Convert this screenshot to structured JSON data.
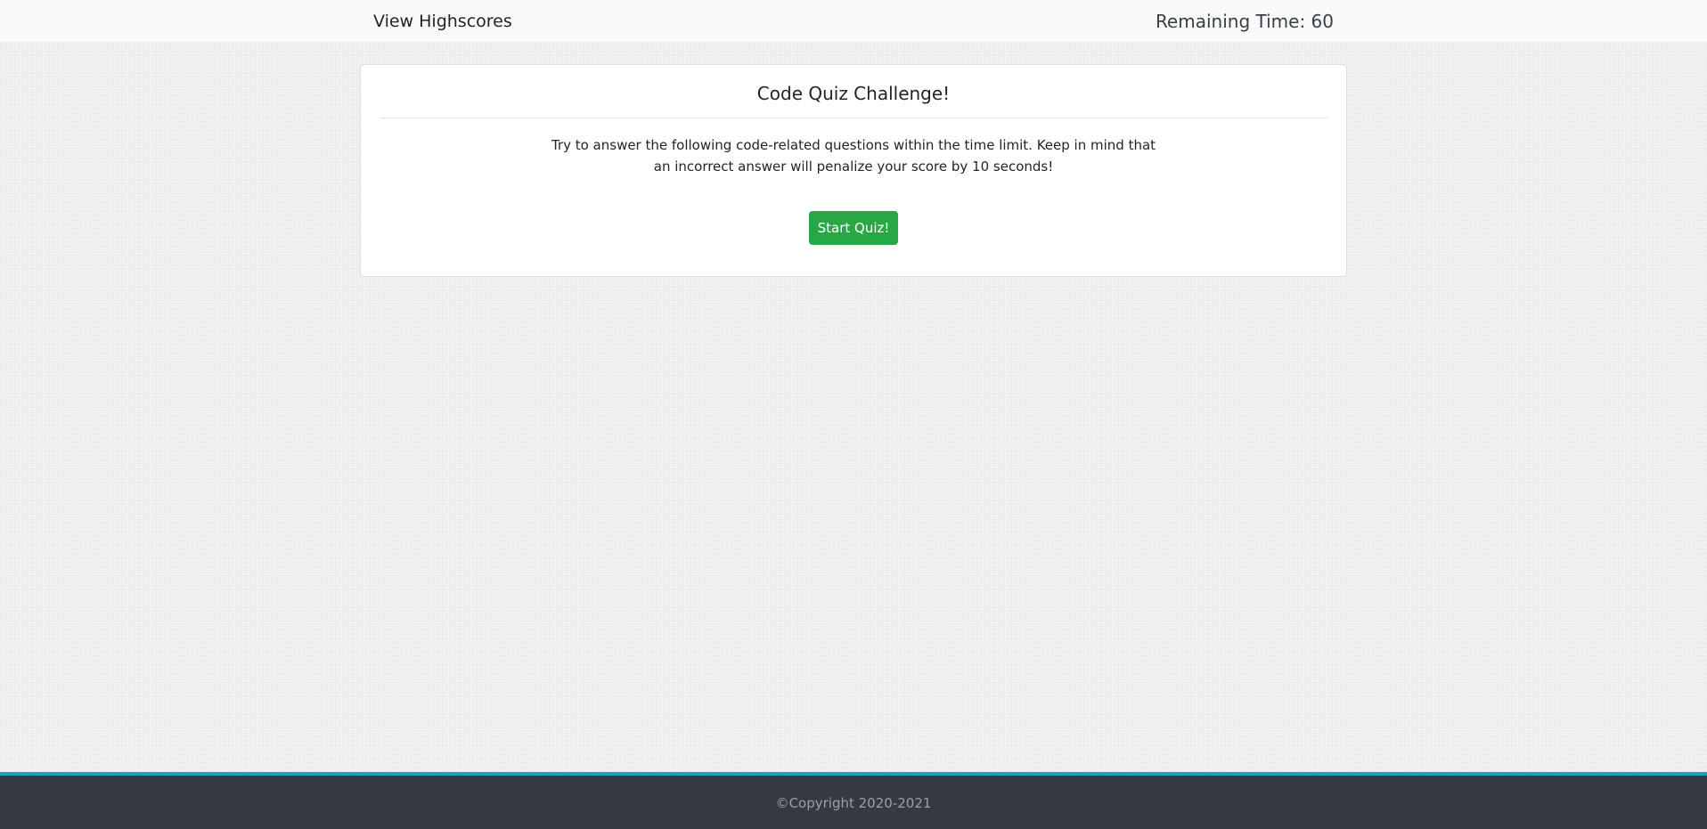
{
  "navbar": {
    "highscores_link": "View Highscores",
    "timer_label": "Remaining Time: 60"
  },
  "card": {
    "title": "Code Quiz Challenge!",
    "description": "Try to answer the following code-related questions within the time limit. Keep in mind that an incorrect answer will penalize your score by 10 seconds!",
    "start_button": "Start Quiz!"
  },
  "footer": {
    "copyright": "©Copyright 2020-2021"
  },
  "colors": {
    "button": "#28a745",
    "footer_bg": "#343a40",
    "footer_accent": "#17a2b8",
    "navbar_bg": "#f8f9fa"
  }
}
